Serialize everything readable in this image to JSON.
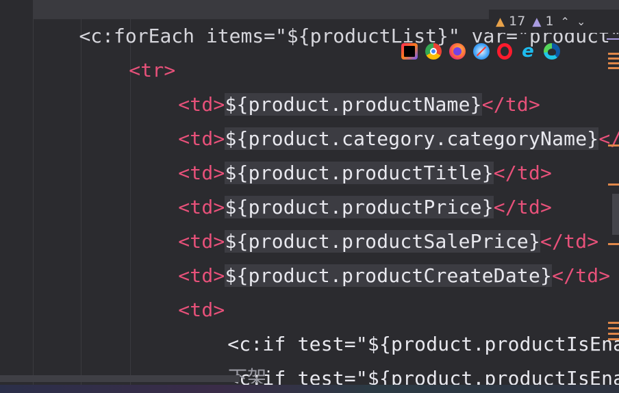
{
  "editor": {
    "top_partial": "<c:forEach items=\"${productList}\" var=\"product\">",
    "lines": {
      "tr_open": "<tr>",
      "l1": {
        "open": "<td>",
        "expr": "${product.productName}",
        "close": "</td>"
      },
      "l2": {
        "open": "<td>",
        "expr": "${product.category.categoryName}",
        "close": "</td"
      },
      "l3": {
        "open": "<td>",
        "expr": "${product.productTitle}",
        "close": "</td>"
      },
      "l4": {
        "open": "<td>",
        "expr": "${product.productPrice}",
        "close": "</td>"
      },
      "l5": {
        "open": "<td>",
        "expr": "${product.productSalePrice}",
        "close": "</td>"
      },
      "l6": {
        "open": "<td>",
        "expr": "${product.productCreateDate}",
        "close": "</td>"
      },
      "td_open": "<td>",
      "if1": "<c:if test=\"${product.productIsEnabl",
      "if2": "<c:if test=\"${product.productIsEnab"
    },
    "bottom_partial": "下架"
  },
  "inspections": {
    "warnings": "17",
    "weak_warnings": "1"
  },
  "browsers": [
    "jetbrains-icon",
    "chrome-icon",
    "firefox-icon",
    "safari-icon",
    "opera-icon",
    "ie-icon",
    "edge-icon"
  ],
  "colors": {
    "background": "#2b2b2f",
    "tag": "#e8517a",
    "attribute": "#56c6d8",
    "keyword": "#e0884a",
    "highlight": "#3c3c42"
  }
}
